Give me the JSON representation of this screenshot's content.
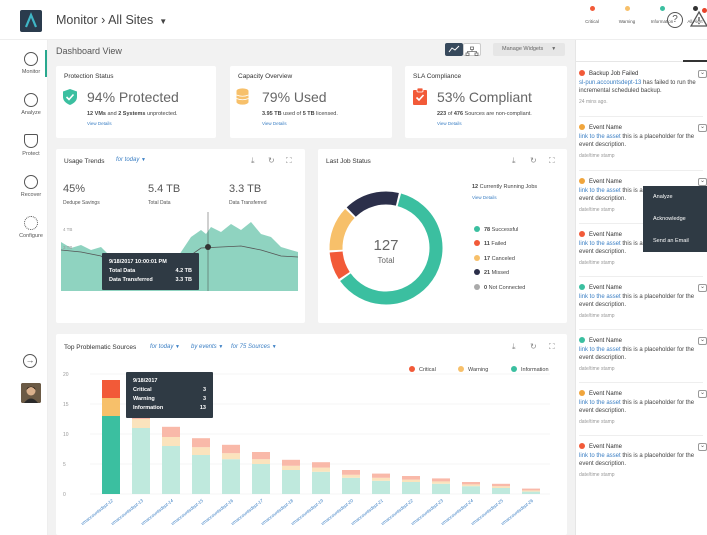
{
  "breadcrumb": "Monitor  ›  All Sites",
  "sidebar": {
    "items": [
      {
        "label": "Monitor",
        "icon": "monitor-icon"
      },
      {
        "label": "Analyze",
        "icon": "analyze-icon"
      },
      {
        "label": "Protect",
        "icon": "protect-icon"
      },
      {
        "label": "Recover",
        "icon": "recover-icon"
      },
      {
        "label": "Configure",
        "icon": "configure-icon"
      }
    ]
  },
  "dashboard": {
    "title": "Dashboard View",
    "manage_widgets": "Manage Widgets"
  },
  "protection": {
    "title": "Protection Status",
    "value": "94% Protected",
    "line_part1": "12 VMs",
    "line_part2": " and ",
    "line_part3": "2 Systems",
    "line_part4": " unprotected.",
    "link": "View Details"
  },
  "capacity": {
    "title": "Capacity Overview",
    "value": "79% Used",
    "line_part1": "3.95 TB",
    "line_part2": " used of ",
    "line_part3": "5 TB",
    "line_part4": " licensed.",
    "link": "View Details"
  },
  "sla": {
    "title": "SLA Compliance",
    "value": "53% Compliant",
    "line_part1": "223",
    "line_part2": " of ",
    "line_part3": "476",
    "line_part4": " Sources are non-compliant.",
    "link": "View Details"
  },
  "usage": {
    "title": "Usage Trends",
    "filter": "for today",
    "metrics": [
      {
        "value": "45%",
        "label": "Dedupe Savings"
      },
      {
        "value": "5.4 TB",
        "label": "Total Data"
      },
      {
        "value": "3.3 TB",
        "label": "Data Transferred"
      }
    ],
    "yticks": [
      "4 TB",
      "3 TB"
    ],
    "tooltip": {
      "date": "9/18/2017 10:00:01 PM",
      "rows": [
        {
          "label": "Total Data",
          "value": "4.2 TB"
        },
        {
          "label": "Data Transferred",
          "value": "3.3 TB"
        }
      ]
    }
  },
  "last_job": {
    "title": "Last Job Status",
    "running_count": "12",
    "running_text": " Currently Running Jobs",
    "link": "View Details",
    "total": "127",
    "total_label": "Total",
    "legend": [
      {
        "count": "78",
        "label": " Successful",
        "color": "#3bbfa0"
      },
      {
        "count": "11",
        "label": " Failed",
        "color": "#f25a38"
      },
      {
        "count": "17",
        "label": " Canceled",
        "color": "#f7c06a"
      },
      {
        "count": "21",
        "label": " Missed",
        "color": "#2b2f4a"
      },
      {
        "count": "0",
        "label": " Not Connected",
        "color": "#aaaaaa"
      }
    ]
  },
  "problematic": {
    "title": "Top Problematic Sources",
    "filter1": "for today",
    "filter2": "by events",
    "filter3": "for 75 Sources",
    "legend": [
      {
        "label": "Critical",
        "color": "#f25a38"
      },
      {
        "label": "Warning",
        "color": "#f7c06a"
      },
      {
        "label": "Information",
        "color": "#3bbfa0"
      }
    ],
    "tooltip": {
      "date": "9/18/2017",
      "rows": [
        {
          "label": "Critical",
          "value": "3"
        },
        {
          "label": "Warning",
          "value": "3"
        },
        {
          "label": "Information",
          "value": "13"
        }
      ]
    }
  },
  "chart_data": {
    "type": "bar",
    "stacked": true,
    "yticks": [
      "20",
      "15",
      "10",
      "5",
      "0"
    ],
    "ylim": [
      0,
      20
    ],
    "categories": [
      "vmaccountsdept-12",
      "vmaccountsdept-13",
      "vmaccountsdept-14",
      "vmaccountsdept-15",
      "vmaccountsdept-16",
      "vmaccountsdept-17",
      "vmaccountsdept-18",
      "vmaccountsdept-19",
      "vmaccountsdept-20",
      "vmaccountsdept-21",
      "vmaccountsdept-22",
      "vmaccountsdept-23",
      "vmaccountsdept-24",
      "vmaccountsdept-25",
      "vmaccountsdept-26"
    ],
    "series": [
      {
        "name": "Information",
        "values": [
          13,
          11,
          8,
          6.5,
          5.8,
          5,
          4,
          3.7,
          2.7,
          2.2,
          2,
          1.7,
          1.3,
          1,
          0.4
        ]
      },
      {
        "name": "Warning",
        "values": [
          3,
          1.5,
          1.5,
          1.3,
          1,
          0.8,
          0.7,
          0.7,
          0.5,
          0.5,
          0.4,
          0.4,
          0.3,
          0.3,
          0.2
        ]
      },
      {
        "name": "Critical",
        "values": [
          3,
          1.5,
          1.7,
          1.5,
          1.4,
          1.2,
          1,
          0.9,
          0.8,
          0.7,
          0.6,
          0.5,
          0.4,
          0.4,
          0.3
        ]
      }
    ]
  },
  "right_panel": {
    "tabs": [
      {
        "label": "Critical",
        "color": "#f25a38"
      },
      {
        "label": "Warning",
        "color": "#f7c06a"
      },
      {
        "label": "Information",
        "color": "#3bbfa0"
      },
      {
        "label": "All Alert",
        "color": "#333333"
      }
    ],
    "alerts": [
      {
        "head": "Backup Job Failed",
        "link": "sl-pun.accountsdept-13",
        "text": " has failed to run the incremental scheduled backup.",
        "ts": "24 mins ago.",
        "color": "#f25a38"
      },
      {
        "head": "Event Name",
        "link": "link to the asset",
        "text": " this is a placeholder for the event description.",
        "ts": "date/time stamp",
        "color": "#f0a53c"
      },
      {
        "head": "Event Name",
        "link": "link to the asset",
        "text": " this is a placeholder for the event description.",
        "ts": "date/time stamp",
        "color": "#f0a53c"
      },
      {
        "head": "Event Name",
        "link": "link to the asset",
        "text": " this is a placeholder for the event description.",
        "ts": "date/time stamp",
        "color": "#f25a38"
      },
      {
        "head": "Event Name",
        "link": "link to the asset",
        "text": " this is a placeholder for the event description.",
        "ts": "date/time stamp",
        "color": "#3bbfa0"
      },
      {
        "head": "Event Name",
        "link": "link to the asset",
        "text": " this is a placeholder for the event description.",
        "ts": "date/time stamp",
        "color": "#3bbfa0"
      },
      {
        "head": "Event Name",
        "link": "link to the asset",
        "text": " this is a placeholder for the event description.",
        "ts": "date/time stamp",
        "color": "#f0a53c"
      },
      {
        "head": "Event Name",
        "link": "link to the asset",
        "text": " this is a placeholder for the event description.",
        "ts": "date/time stamp",
        "color": "#f25a38"
      }
    ],
    "menu": [
      "Analyze",
      "Acknowledge",
      "Send an Email"
    ]
  }
}
